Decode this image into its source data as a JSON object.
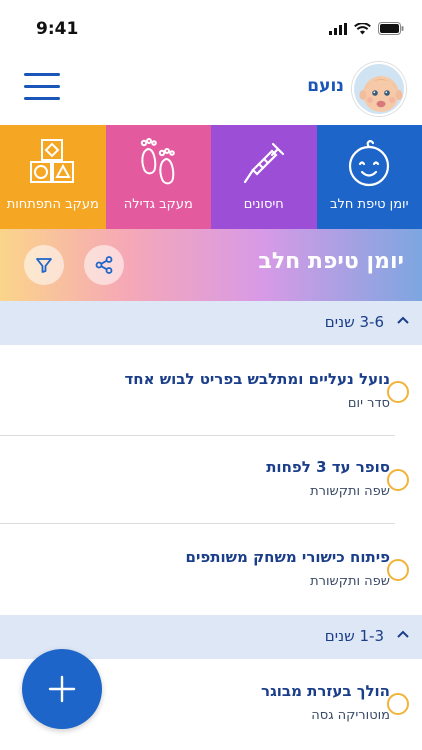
{
  "status_bar": {
    "time": "9:41"
  },
  "header": {
    "user_name": "נועם"
  },
  "tabs": [
    {
      "label": "יומן טיפת חלב",
      "icon": "baby-face-icon",
      "color": "#1d65c8",
      "selected": true
    },
    {
      "label": "חיסונים",
      "icon": "syringe-icon",
      "color": "#9c4fd6",
      "selected": false
    },
    {
      "label": "מעקב גדילה",
      "icon": "footprints-icon",
      "color": "#e45a9f",
      "selected": false
    },
    {
      "label": "מעקב התפתחות",
      "icon": "shape-blocks-icon",
      "color": "#f5a623",
      "selected": false
    }
  ],
  "banner": {
    "title": "יומן טיפת חלב"
  },
  "sections": [
    {
      "label": "3-6 שנים",
      "items": [
        {
          "title": "נועל נעליים ומתלבש בפריט לבוש אחד",
          "subtitle": "סדר יום"
        },
        {
          "title": "סופר עד 3 לפחות",
          "subtitle": "שפה ותקשורת"
        },
        {
          "title": "פיתוח כישורי משחק משותפים",
          "subtitle": "שפה ותקשורת"
        }
      ]
    },
    {
      "label": "1-3 שנים",
      "items": [
        {
          "title": "הולך בעזרת מבוגר",
          "subtitle": "מוטוריקה גסה"
        }
      ]
    }
  ],
  "fab": {
    "icon": "plus-icon"
  },
  "colors": {
    "primary": "#1d65c8",
    "text": "#1b3e8a",
    "accent": "#f0b43a"
  }
}
